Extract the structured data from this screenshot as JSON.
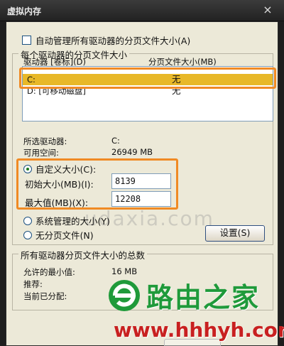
{
  "window": {
    "title": "虚拟内存",
    "close_glyph": "×"
  },
  "auto_manage": {
    "label": "自动管理所有驱动器的分页文件大小(A)",
    "checked": false
  },
  "per_drive_group": {
    "title": "每个驱动器的分页文件大小",
    "col_drive": "驱动器 [卷标](D)",
    "col_size": "分页文件大小(MB)",
    "rows": [
      {
        "drive": "C:",
        "size": "无",
        "selected": true
      },
      {
        "drive": "D:    [可移动磁盘]",
        "size": "无",
        "selected": false
      }
    ]
  },
  "selected_drive": {
    "label": "所选驱动器:",
    "value": "C:",
    "space_label": "可用空间:",
    "space_value": "26949 MB"
  },
  "custom": {
    "radio_label": "自定义大小(C):",
    "initial_label": "初始大小(MB)(I):",
    "initial_value": "8139",
    "max_label": "最大值(MB)(X):",
    "max_value": "12208"
  },
  "system_managed": {
    "label": "系统管理的大小(Y)"
  },
  "no_paging": {
    "label": "无分页文件(N)"
  },
  "set_button": {
    "label": "设置(S)"
  },
  "totals_group": {
    "title": "所有驱动器分页文件大小的总数",
    "min_label": "允许的最小值:",
    "min_value": "16 MB",
    "rec_label": "推荐:",
    "cur_label": "当前已分配:"
  },
  "watermarks": {
    "url_text": "udaxia.com",
    "brand_text": "路由之家",
    "site_url": "www.hhhyh.com"
  },
  "colors": {
    "selection": "#e8b828",
    "highlight_box": "#f08a24",
    "brand_green": "#1f9a3a",
    "site_red": "#c82020"
  }
}
